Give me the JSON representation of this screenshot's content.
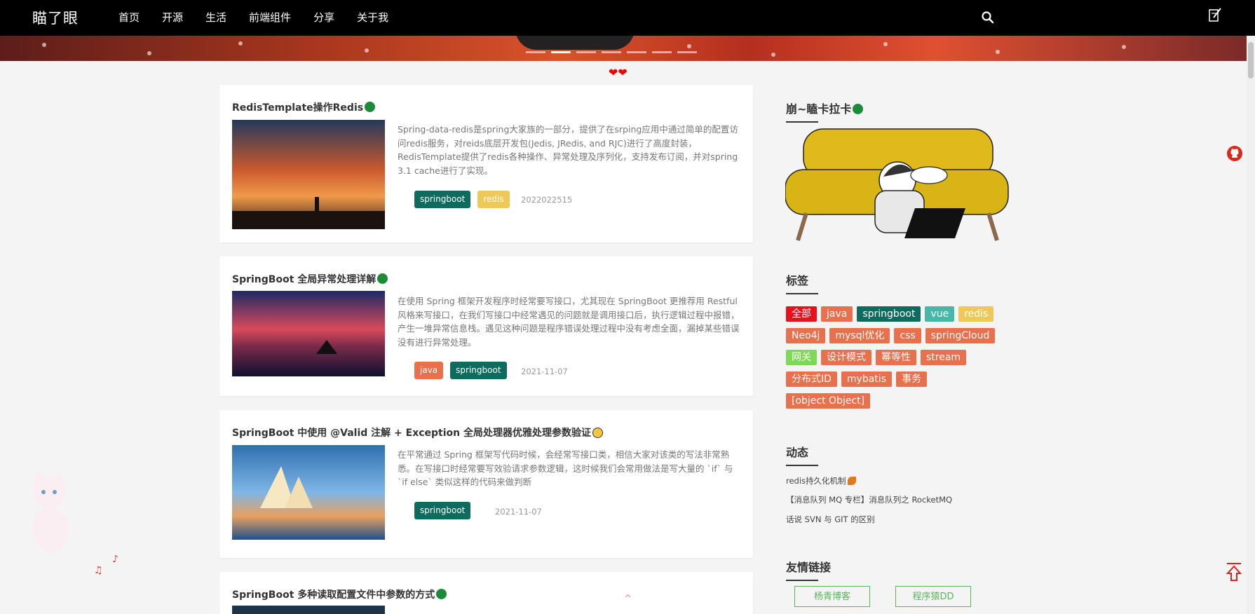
{
  "site": {
    "logo": "瞄了眼"
  },
  "nav": {
    "items": [
      "首页",
      "开源",
      "生活",
      "前端组件",
      "分享",
      "关于我"
    ]
  },
  "icons": {
    "search": "search-icon",
    "edit": "pencil-icon",
    "github": "github-icon",
    "back_to_top": "arrow-up-icon"
  },
  "articles": [
    {
      "title": "RedisTemplate操作Redis",
      "excerpt": "Spring-data-redis是spring大家族的一部分，提供了在srping应用中通过简单的配置访问redis服务，对reids底层开发包(Jedis, JRedis, and RJC)进行了高度封装，RedisTemplate提供了redis各种操作、异常处理及序列化，支持发布订阅，并对spring 3.1 cache进行了实现。",
      "tags": [
        {
          "label": "springboot",
          "color": "#0e6b5e"
        },
        {
          "label": "redis",
          "color": "#eec95a"
        }
      ],
      "date": "2022022515"
    },
    {
      "title": "SpringBoot 全局异常处理详解",
      "excerpt": "在使用 Spring 框架开发程序时经常要写接口，尤其现在 SpringBoot 更推荐用 Restful 风格来写接口，在我们写接口中经常遇见的问题就是调用接口后，执行逻辑过程中报错，产生一堆异常信息栈。遇见这种问题是程序错误处理过程中没有考虑全面，漏掉某些错误没有进行异常处理。",
      "tags": [
        {
          "label": "java",
          "color": "#e8704d"
        },
        {
          "label": "springboot",
          "color": "#0e6b5e"
        }
      ],
      "date": "2021-11-07"
    },
    {
      "title": "SpringBoot 中使用 @Valid 注解 + Exception 全局处理器优雅处理参数验证",
      "excerpt": "在平常通过 Spring 框架写代码时候，会经常写接口类，相信大家对该类的写法非常熟悉。在写接口时经常要写效验请求参数逻辑，这时候我们会常用做法是写大量的 `if` 与 `if else` 类似这样的代码来做判断",
      "tags": [
        {
          "label": "springboot",
          "color": "#0e6b5e"
        }
      ],
      "date": "2021-11-07"
    },
    {
      "title": "SpringBoot 多种读取配置文件中参数的方式"
    }
  ],
  "sidebar": {
    "profile_title": "崩~瞌卡拉卡",
    "tags_title": "标签",
    "tags": [
      [
        {
          "label": "全部",
          "color": "#e8101a"
        },
        {
          "label": "java",
          "color": "#e8704d"
        },
        {
          "label": "springboot",
          "color": "#0e6b5e"
        },
        {
          "label": "vue",
          "color": "#47b8a8"
        },
        {
          "label": "redis",
          "color": "#eec95a"
        }
      ],
      [
        {
          "label": "Neo4j",
          "color": "#e8704d"
        },
        {
          "label": "mysql优化",
          "color": "#e8704d"
        },
        {
          "label": "css",
          "color": "#e8704d"
        },
        {
          "label": "springCloud",
          "color": "#e8704d"
        }
      ],
      [
        {
          "label": "网关",
          "color": "#7ed957"
        },
        {
          "label": "设计模式",
          "color": "#e8704d"
        },
        {
          "label": "幂等性",
          "color": "#e8704d"
        },
        {
          "label": "stream",
          "color": "#e8704d"
        }
      ],
      [
        {
          "label": "分布式ID",
          "color": "#e8704d"
        },
        {
          "label": "mybatis",
          "color": "#e8704d"
        },
        {
          "label": "事务",
          "color": "#e8704d"
        }
      ],
      [
        {
          "label": "[object Object]",
          "color": "#e8704d"
        }
      ]
    ],
    "news_title": "动态",
    "news": [
      "redis持久化机制",
      "【消息队列 MQ 专栏】消息队列之 RocketMQ",
      "话说 SVN 与 GIT 的区别"
    ],
    "links_title": "友情链接",
    "links": [
      "杨青博客",
      "程序猿DD"
    ]
  }
}
